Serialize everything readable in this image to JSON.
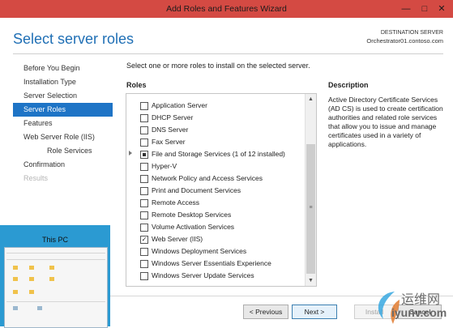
{
  "window": {
    "title": "Add Roles and Features Wizard"
  },
  "header": {
    "page_title": "Select server roles",
    "destination_label": "DESTINATION SERVER",
    "destination_server": "Orchestrator01.contoso.com"
  },
  "nav": {
    "items": [
      {
        "label": "Before You Begin"
      },
      {
        "label": "Installation Type"
      },
      {
        "label": "Server Selection"
      },
      {
        "label": "Server Roles"
      },
      {
        "label": "Features"
      },
      {
        "label": "Web Server Role (IIS)"
      },
      {
        "label": "Role Services"
      },
      {
        "label": "Confirmation"
      },
      {
        "label": "Results"
      }
    ]
  },
  "main": {
    "instruction": "Select one or more roles to install on the selected server.",
    "roles_label": "Roles",
    "roles": [
      {
        "label": "Application Server",
        "checked": false
      },
      {
        "label": "DHCP Server",
        "checked": false
      },
      {
        "label": "DNS Server",
        "checked": false
      },
      {
        "label": "Fax Server",
        "checked": false
      },
      {
        "label": "File and Storage Services (1 of 12 installed)",
        "checked": "partial"
      },
      {
        "label": "Hyper-V",
        "checked": false
      },
      {
        "label": "Network Policy and Access Services",
        "checked": false
      },
      {
        "label": "Print and Document Services",
        "checked": false
      },
      {
        "label": "Remote Access",
        "checked": false
      },
      {
        "label": "Remote Desktop Services",
        "checked": false
      },
      {
        "label": "Volume Activation Services",
        "checked": false
      },
      {
        "label": "Web Server (IIS)",
        "checked": true
      },
      {
        "label": "Windows Deployment Services",
        "checked": false
      },
      {
        "label": "Windows Server Essentials Experience",
        "checked": false
      },
      {
        "label": "Windows Server Update Services",
        "checked": false
      }
    ]
  },
  "description": {
    "label": "Description",
    "text": "Active Directory Certificate Services (AD CS) is used to create certification authorities and related role services that allow you to issue and manage certificates used in a variety of applications."
  },
  "buttons": {
    "previous": "< Previous",
    "next": "Next >",
    "install": "Install",
    "cancel": "Cancel"
  },
  "thumbnail": {
    "title": "This PC"
  },
  "watermark": {
    "line1": "运维网",
    "line2": "iyunv.com"
  },
  "colors": {
    "titlebar": "#d44a43",
    "accent": "#1e74c6",
    "heading": "#1f6fb5"
  }
}
